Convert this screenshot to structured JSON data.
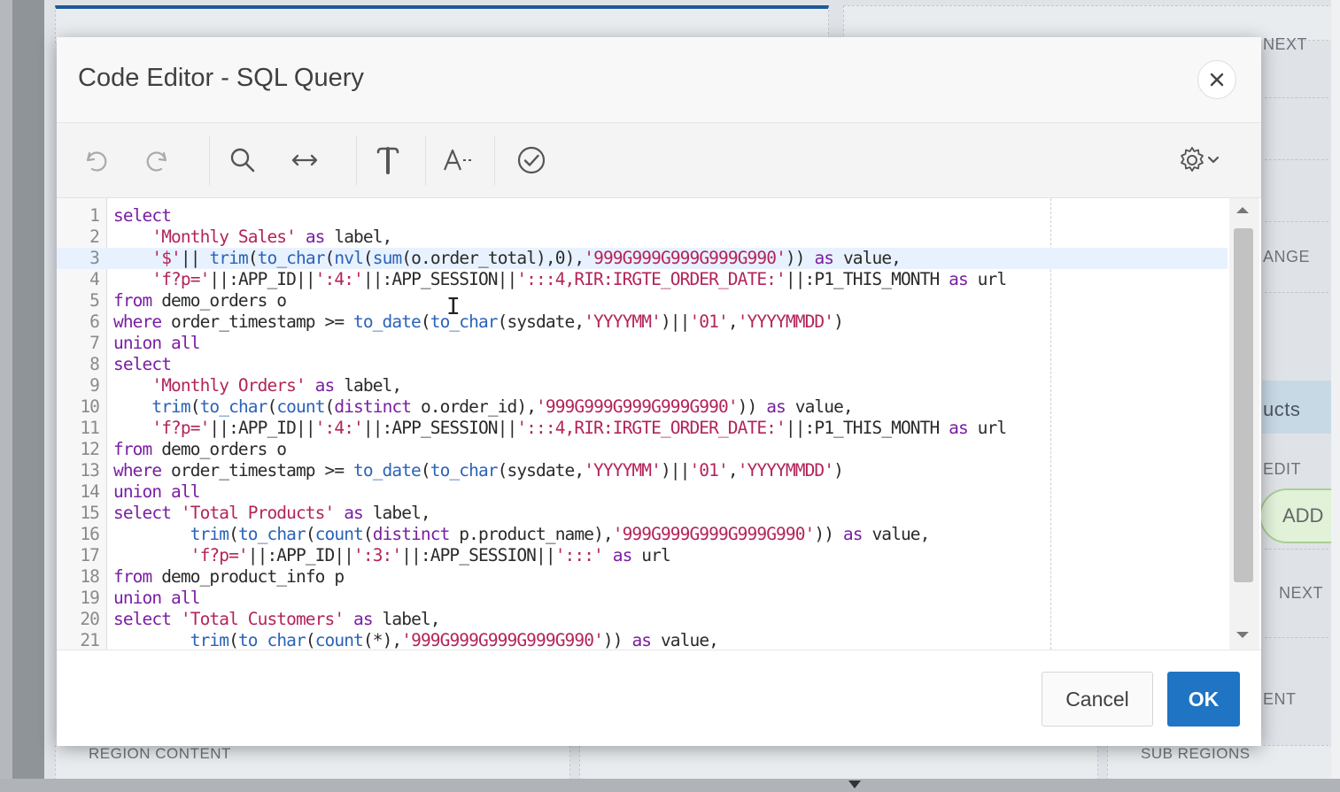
{
  "dialog": {
    "title": "Code Editor - SQL Query",
    "close_icon": "close-icon",
    "cancel_label": "Cancel",
    "ok_label": "OK"
  },
  "toolbar": {
    "icons": [
      "undo-icon",
      "redo-icon",
      "search-icon",
      "replace-icon",
      "format-icon",
      "font-size-icon",
      "validate-icon",
      "settings-icon"
    ]
  },
  "editor": {
    "lines": [
      {
        "n": "1",
        "tokens": [
          [
            "kw",
            "select"
          ]
        ]
      },
      {
        "n": "2",
        "tokens": [
          [
            "tx",
            "    "
          ],
          [
            "str",
            "'Monthly Sales'"
          ],
          [
            "tx",
            " "
          ],
          [
            "kw",
            "as"
          ],
          [
            "tx",
            " label,"
          ]
        ]
      },
      {
        "n": "3",
        "tokens": [
          [
            "tx",
            "    "
          ],
          [
            "str",
            "'$'"
          ],
          [
            "tx",
            "|| "
          ],
          [
            "fn",
            "trim"
          ],
          [
            "tx",
            "("
          ],
          [
            "fn",
            "to_char"
          ],
          [
            "tx",
            "("
          ],
          [
            "fn",
            "nvl"
          ],
          [
            "tx",
            "("
          ],
          [
            "fn",
            "sum"
          ],
          [
            "tx",
            "(o.order_total),0),"
          ],
          [
            "str",
            "'999G999G999G999G990'"
          ],
          [
            "tx",
            ")) "
          ],
          [
            "kw",
            "as"
          ],
          [
            "tx",
            " value,"
          ]
        ]
      },
      {
        "n": "4",
        "tokens": [
          [
            "tx",
            "    "
          ],
          [
            "str",
            "'f?p='"
          ],
          [
            "tx",
            "||:APP_ID||"
          ],
          [
            "str",
            "':4:'"
          ],
          [
            "tx",
            "||:APP_SESSION||"
          ],
          [
            "str",
            "':::4,RIR:IRGTE_ORDER_DATE:'"
          ],
          [
            "tx",
            "||:P1_THIS_MONTH "
          ],
          [
            "kw",
            "as"
          ],
          [
            "tx",
            " url"
          ]
        ]
      },
      {
        "n": "5",
        "tokens": [
          [
            "kw",
            "from"
          ],
          [
            "tx",
            " demo_orders o"
          ]
        ]
      },
      {
        "n": "6",
        "tokens": [
          [
            "kw",
            "where"
          ],
          [
            "tx",
            " order_timestamp >= "
          ],
          [
            "fn",
            "to_date"
          ],
          [
            "tx",
            "("
          ],
          [
            "fn",
            "to_char"
          ],
          [
            "tx",
            "(sysdate,"
          ],
          [
            "str",
            "'YYYYMM'"
          ],
          [
            "tx",
            ")||"
          ],
          [
            "str",
            "'01'"
          ],
          [
            "tx",
            ","
          ],
          [
            "str",
            "'YYYYMMDD'"
          ],
          [
            "tx",
            ")"
          ]
        ]
      },
      {
        "n": "7",
        "tokens": [
          [
            "kw",
            "union all"
          ]
        ]
      },
      {
        "n": "8",
        "tokens": [
          [
            "kw",
            "select"
          ]
        ]
      },
      {
        "n": "9",
        "tokens": [
          [
            "tx",
            "    "
          ],
          [
            "str",
            "'Monthly Orders'"
          ],
          [
            "tx",
            " "
          ],
          [
            "kw",
            "as"
          ],
          [
            "tx",
            " label,"
          ]
        ]
      },
      {
        "n": "10",
        "tokens": [
          [
            "tx",
            "    "
          ],
          [
            "fn",
            "trim"
          ],
          [
            "tx",
            "("
          ],
          [
            "fn",
            "to_char"
          ],
          [
            "tx",
            "("
          ],
          [
            "fn",
            "count"
          ],
          [
            "tx",
            "("
          ],
          [
            "kw",
            "distinct"
          ],
          [
            "tx",
            " o.order_id),"
          ],
          [
            "str",
            "'999G999G999G999G990'"
          ],
          [
            "tx",
            ")) "
          ],
          [
            "kw",
            "as"
          ],
          [
            "tx",
            " value,"
          ]
        ]
      },
      {
        "n": "11",
        "tokens": [
          [
            "tx",
            "    "
          ],
          [
            "str",
            "'f?p='"
          ],
          [
            "tx",
            "||:APP_ID||"
          ],
          [
            "str",
            "':4:'"
          ],
          [
            "tx",
            "||:APP_SESSION||"
          ],
          [
            "str",
            "':::4,RIR:IRGTE_ORDER_DATE:'"
          ],
          [
            "tx",
            "||:P1_THIS_MONTH "
          ],
          [
            "kw",
            "as"
          ],
          [
            "tx",
            " url"
          ]
        ]
      },
      {
        "n": "12",
        "tokens": [
          [
            "kw",
            "from"
          ],
          [
            "tx",
            " demo_orders o"
          ]
        ]
      },
      {
        "n": "13",
        "tokens": [
          [
            "kw",
            "where"
          ],
          [
            "tx",
            " order_timestamp >= "
          ],
          [
            "fn",
            "to_date"
          ],
          [
            "tx",
            "("
          ],
          [
            "fn",
            "to_char"
          ],
          [
            "tx",
            "(sysdate,"
          ],
          [
            "str",
            "'YYYYMM'"
          ],
          [
            "tx",
            ")||"
          ],
          [
            "str",
            "'01'"
          ],
          [
            "tx",
            ","
          ],
          [
            "str",
            "'YYYYMMDD'"
          ],
          [
            "tx",
            ")"
          ]
        ]
      },
      {
        "n": "14",
        "tokens": [
          [
            "kw",
            "union all"
          ]
        ]
      },
      {
        "n": "15",
        "tokens": [
          [
            "kw",
            "select"
          ],
          [
            "tx",
            " "
          ],
          [
            "str",
            "'Total Products'"
          ],
          [
            "tx",
            " "
          ],
          [
            "kw",
            "as"
          ],
          [
            "tx",
            " label,"
          ]
        ]
      },
      {
        "n": "16",
        "tokens": [
          [
            "tx",
            "        "
          ],
          [
            "fn",
            "trim"
          ],
          [
            "tx",
            "("
          ],
          [
            "fn",
            "to_char"
          ],
          [
            "tx",
            "("
          ],
          [
            "fn",
            "count"
          ],
          [
            "tx",
            "("
          ],
          [
            "kw",
            "distinct"
          ],
          [
            "tx",
            " p.product_name),"
          ],
          [
            "str",
            "'999G999G999G999G990'"
          ],
          [
            "tx",
            ")) "
          ],
          [
            "kw",
            "as"
          ],
          [
            "tx",
            " value,"
          ]
        ]
      },
      {
        "n": "17",
        "tokens": [
          [
            "tx",
            "        "
          ],
          [
            "str",
            "'f?p='"
          ],
          [
            "tx",
            "||:APP_ID||"
          ],
          [
            "str",
            "':3:'"
          ],
          [
            "tx",
            "||:APP_SESSION||"
          ],
          [
            "str",
            "':::'"
          ],
          [
            "tx",
            " "
          ],
          [
            "kw",
            "as"
          ],
          [
            "tx",
            " url"
          ]
        ]
      },
      {
        "n": "18",
        "tokens": [
          [
            "kw",
            "from"
          ],
          [
            "tx",
            " demo_product_info p"
          ]
        ]
      },
      {
        "n": "19",
        "tokens": [
          [
            "kw",
            "union all"
          ]
        ]
      },
      {
        "n": "20",
        "tokens": [
          [
            "kw",
            "select"
          ],
          [
            "tx",
            " "
          ],
          [
            "str",
            "'Total Customers'"
          ],
          [
            "tx",
            " "
          ],
          [
            "kw",
            "as"
          ],
          [
            "tx",
            " label,"
          ]
        ]
      },
      {
        "n": "21",
        "tokens": [
          [
            "tx",
            "        "
          ],
          [
            "fn",
            "trim"
          ],
          [
            "tx",
            "("
          ],
          [
            "fn",
            "to char"
          ],
          [
            "tx",
            "("
          ],
          [
            "fn",
            "count"
          ],
          [
            "tx",
            "(*),"
          ],
          [
            "str",
            "'999G999G999G999G990'"
          ],
          [
            "tx",
            ")) "
          ],
          [
            "kw",
            "as"
          ],
          [
            "tx",
            " value,"
          ]
        ]
      }
    ]
  },
  "background": {
    "labels": {
      "next_top": "NEXT",
      "change": "ANGE",
      "products": "ucts",
      "edit": "EDIT",
      "add": "ADD",
      "next_mid": "NEXT",
      "content": "ENT",
      "region_content": "REGION CONTENT",
      "sub_regions": "SUB REGIONS"
    }
  }
}
